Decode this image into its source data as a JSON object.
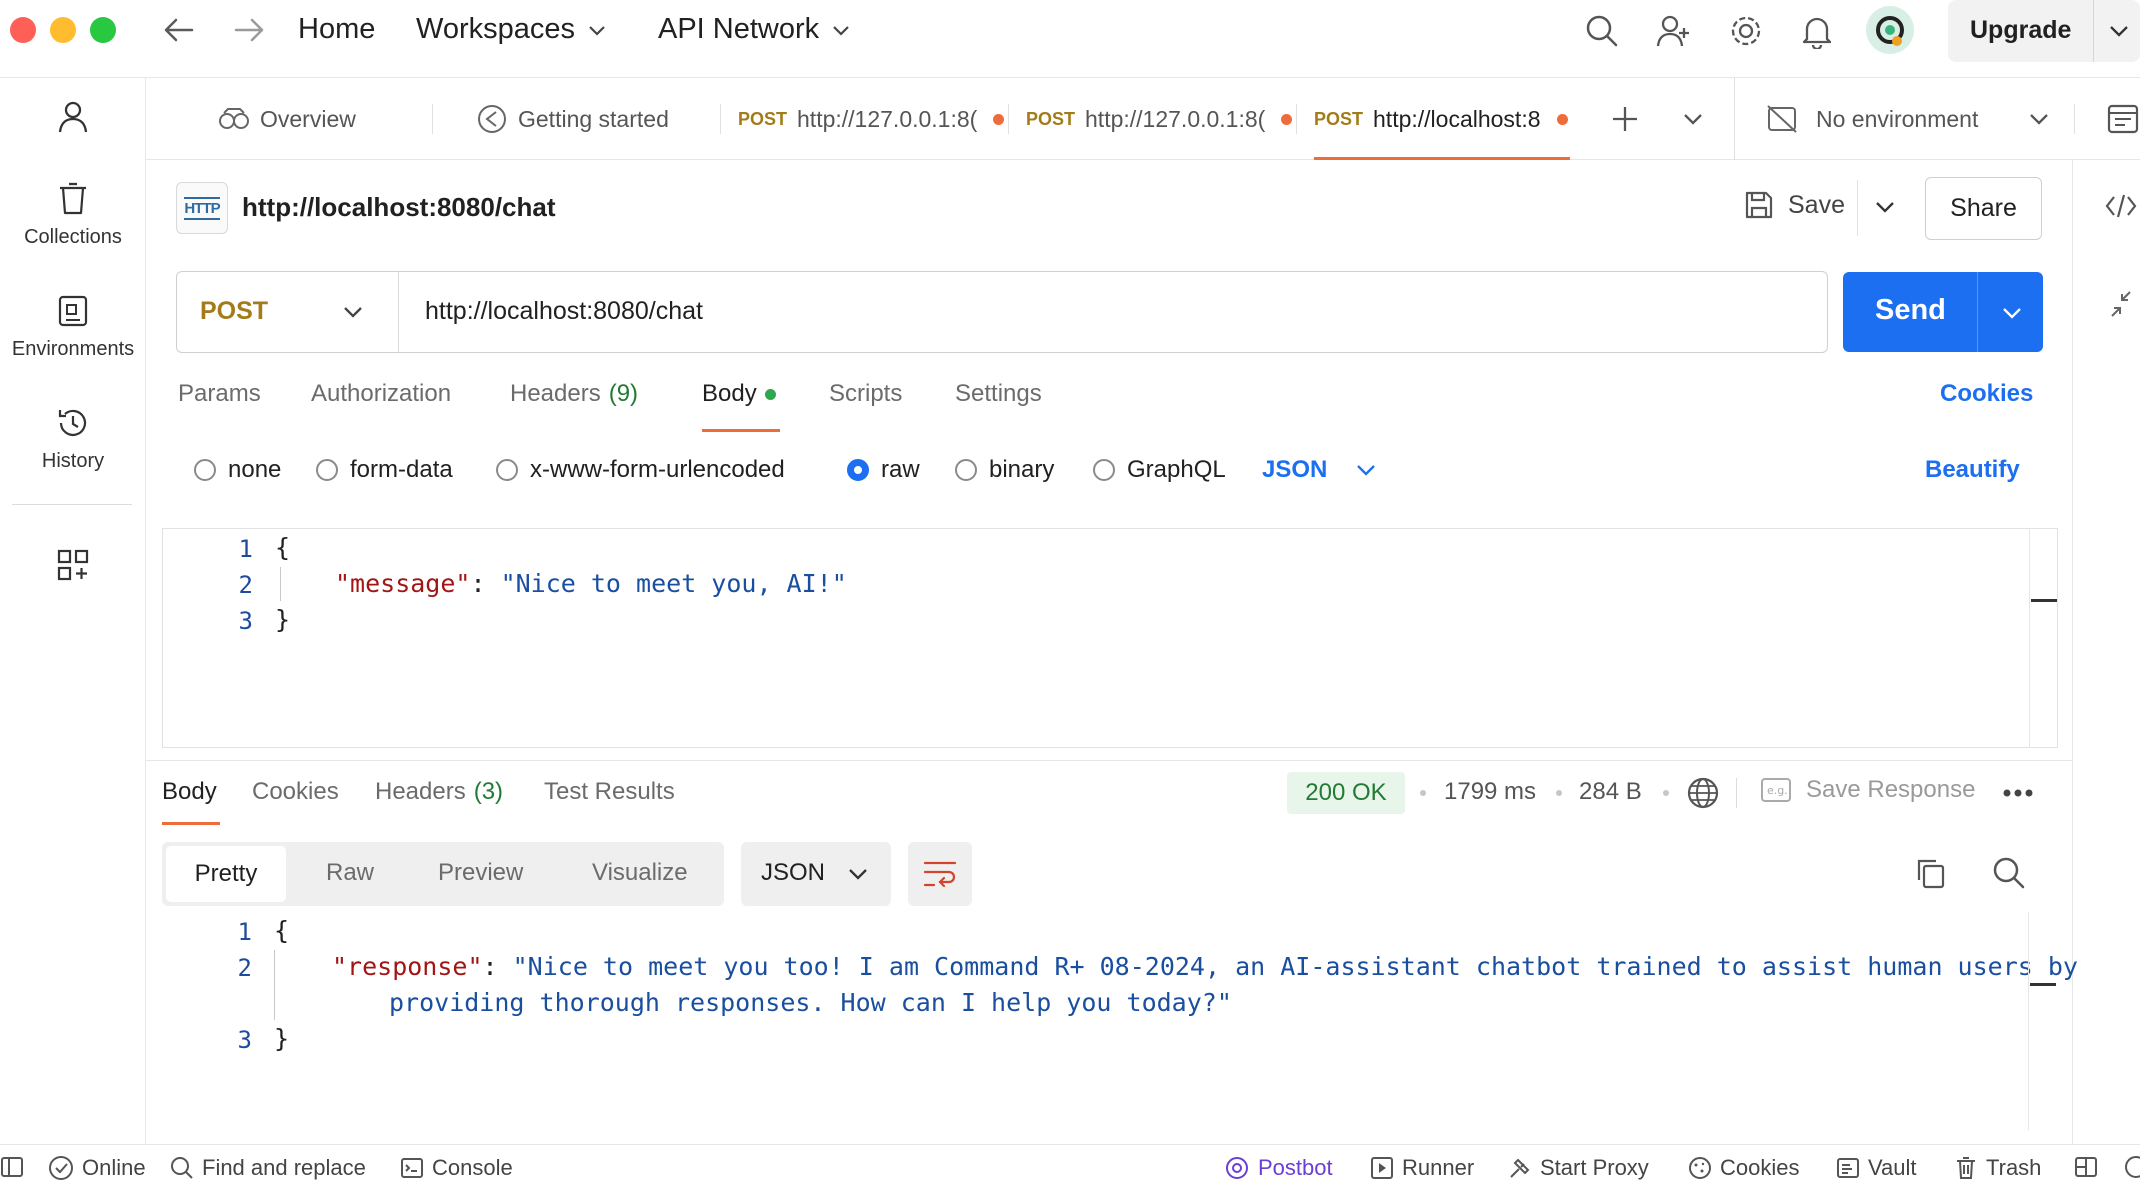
{
  "titlebar": {
    "nav": {
      "home": "Home",
      "workspaces": "Workspaces",
      "api_network": "API Network"
    },
    "upgrade_label": "Upgrade"
  },
  "sidebar": {
    "items": [
      {
        "label": "Collections"
      },
      {
        "label": "Environments"
      },
      {
        "label": "History"
      }
    ]
  },
  "tabs": {
    "items": [
      {
        "label": "Overview"
      },
      {
        "label": "Getting started"
      },
      {
        "method": "POST",
        "label": "http://127.0.0.1:8("
      },
      {
        "method": "POST",
        "label": "http://127.0.0.1:8("
      },
      {
        "method": "POST",
        "label": "http://localhost:8"
      }
    ],
    "environment": "No environment"
  },
  "request": {
    "title": "http://localhost:8080/chat",
    "save_label": "Save",
    "share_label": "Share",
    "method": "POST",
    "url": "http://localhost:8080/chat",
    "send_label": "Send",
    "subtabs": {
      "params": "Params",
      "authorization": "Authorization",
      "headers": "Headers",
      "headers_count": "(9)",
      "body": "Body",
      "scripts": "Scripts",
      "settings": "Settings",
      "cookies": "Cookies"
    },
    "body_types": [
      "none",
      "form-data",
      "x-www-form-urlencoded",
      "raw",
      "binary",
      "GraphQL"
    ],
    "body_selected": "raw",
    "format": "JSON",
    "beautify_label": "Beautify",
    "body_lines": {
      "l1_no": "1",
      "l1": "{",
      "l2_no": "2",
      "l2_key": "\"message\"",
      "l2_colon": ": ",
      "l2_val": "\"Nice to meet you, AI!\"",
      "l3_no": "3",
      "l3": "}"
    }
  },
  "response": {
    "tabs": {
      "body": "Body",
      "cookies": "Cookies",
      "headers": "Headers",
      "headers_count": "(3)",
      "test_results": "Test Results"
    },
    "status": "200 OK",
    "time": "1799 ms",
    "size": "284 B",
    "save_response_label": "Save Response",
    "view_modes": [
      "Pretty",
      "Raw",
      "Preview",
      "Visualize"
    ],
    "format": "JSON",
    "lines": {
      "l1_no": "1",
      "l1": "{",
      "l2_no": "2",
      "l2_key": "\"response\"",
      "l2_colon": ": ",
      "l2_val_a": "\"Nice to meet you too! I am Command R+ 08-2024, an AI-assistant chatbot trained to assist human users by",
      "l2_val_b": "providing thorough responses. How can I help you today?\"",
      "l3_no": "3",
      "l3": "}"
    }
  },
  "statusbar": {
    "online": "Online",
    "find_replace": "Find and replace",
    "console": "Console",
    "postbot": "Postbot",
    "runner": "Runner",
    "start_proxy": "Start Proxy",
    "cookies": "Cookies",
    "vault": "Vault",
    "trash": "Trash"
  },
  "colors": {
    "accent_blue": "#1b6ff0",
    "method_post": "#a37c1a",
    "unsaved_dot": "#ee6c3a",
    "status_ok_bg": "#e8f5ea",
    "status_ok_text": "#237a35",
    "postbot": "#6b3fd6"
  }
}
